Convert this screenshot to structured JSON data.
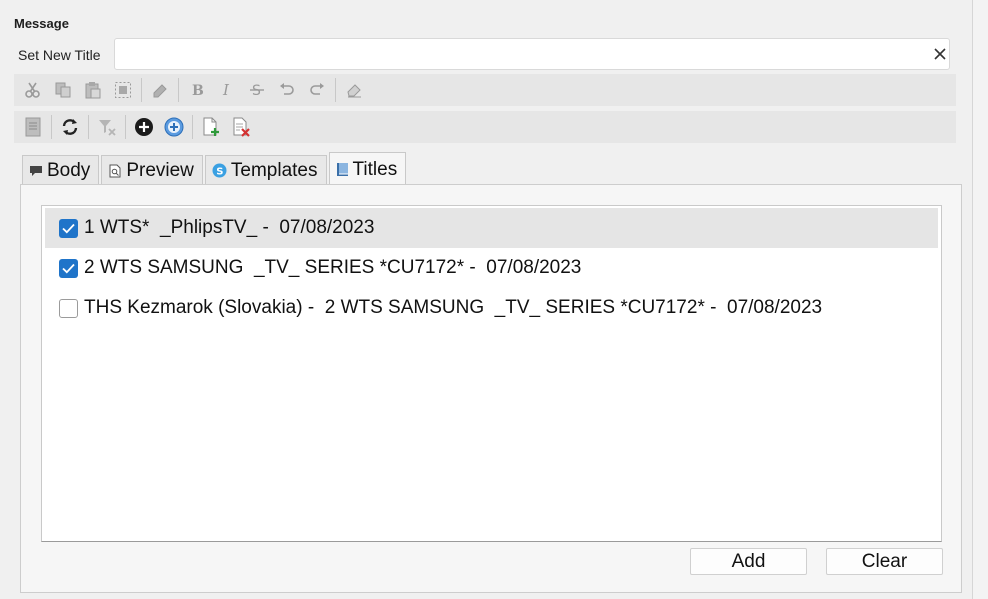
{
  "group": {
    "title": "Message"
  },
  "title_field": {
    "label": "Set New Title",
    "value": "",
    "placeholder": ""
  },
  "toolbar1": {
    "buttons": [
      "cut-icon",
      "copy-icon",
      "paste-icon",
      "select-all-icon",
      "eraser-icon",
      "bold-icon",
      "italic-icon",
      "strikethrough-icon",
      "undo-icon",
      "redo-icon",
      "clear-format-icon"
    ]
  },
  "toolbar2": {
    "buttons": [
      "document-icon",
      "refresh-icon",
      "filter-clear-icon",
      "add-icon",
      "add-circle-icon",
      "new-file-icon",
      "delete-file-icon"
    ]
  },
  "tabs": [
    {
      "label": "Body",
      "icon": "comment-icon"
    },
    {
      "label": "Preview",
      "icon": "preview-icon"
    },
    {
      "label": "Templates",
      "icon": "skype-icon"
    },
    {
      "label": "Titles",
      "icon": "book-icon",
      "active": true
    }
  ],
  "titles": [
    {
      "text": "1 WTS*  _PhlipsTV_ -  07/08/2023",
      "checked": true,
      "selected": true
    },
    {
      "text": "2 WTS SAMSUNG  _TV_ SERIES *CU7172* -  07/08/2023",
      "checked": true,
      "selected": false
    },
    {
      "text": "THS Kezmarok (Slovakia) -  2 WTS SAMSUNG  _TV_ SERIES *CU7172* -  07/08/2023",
      "checked": false,
      "selected": false
    }
  ],
  "buttons": {
    "add": "Add",
    "clear": "Clear"
  },
  "colors": {
    "checkbox_accent": "#1f74c9",
    "selected_row": "#e5e5e5"
  }
}
